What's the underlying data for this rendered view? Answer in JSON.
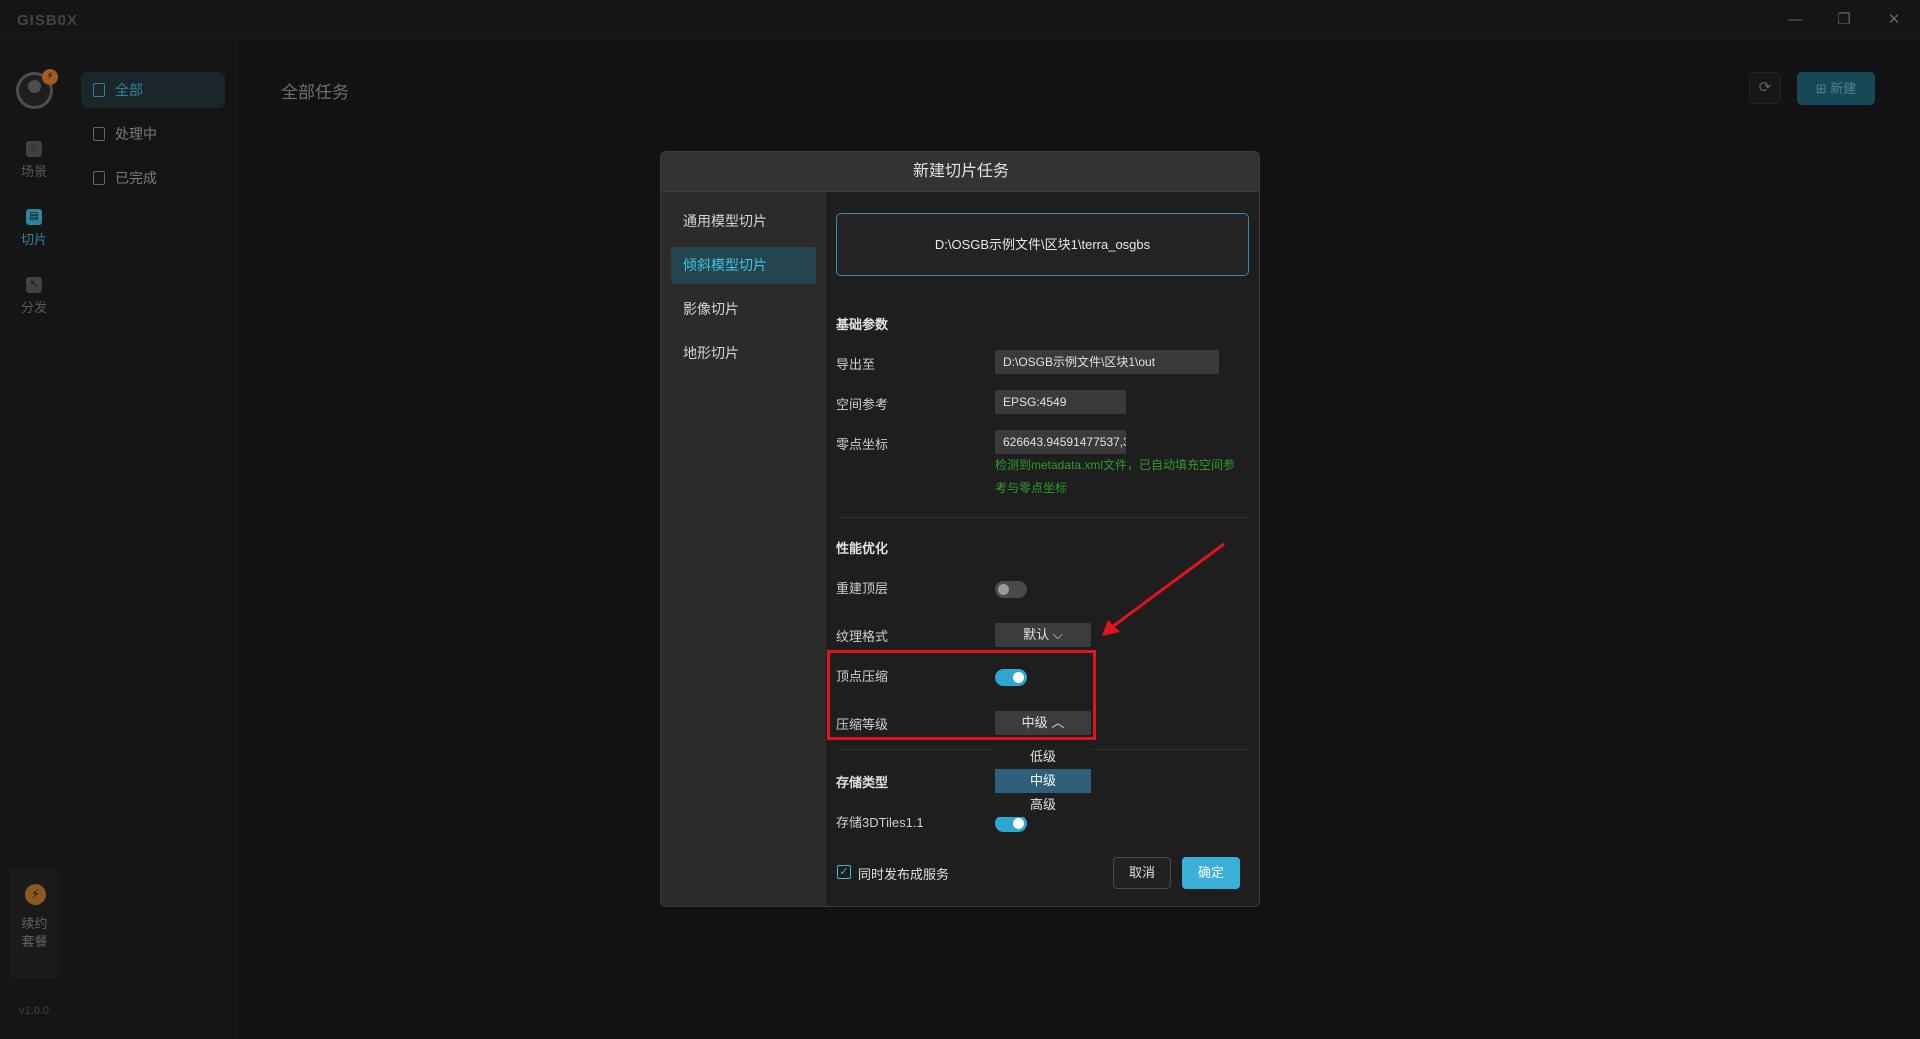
{
  "app": {
    "logo": "GISB0X",
    "version": "v1.0.0",
    "window_controls": [
      "minimize-icon",
      "restore-icon",
      "close-icon"
    ]
  },
  "rail": {
    "items": [
      {
        "label": "场景",
        "icon": "scene-icon",
        "active": false
      },
      {
        "label": "切片",
        "icon": "slice-icon",
        "active": true
      },
      {
        "label": "分发",
        "icon": "distribute-icon",
        "active": false
      }
    ],
    "renew_label_1": "续约",
    "renew_label_2": "套餐"
  },
  "sidebar": {
    "items": [
      {
        "label": "全部",
        "active": true
      },
      {
        "label": "处理中",
        "active": false
      },
      {
        "label": "已完成",
        "active": false
      }
    ]
  },
  "main": {
    "title": "全部任务",
    "new_button": "新建"
  },
  "dialog": {
    "title": "新建切片任务",
    "nav": [
      {
        "label": "通用模型切片",
        "active": false
      },
      {
        "label": "倾斜模型切片",
        "active": true
      },
      {
        "label": "影像切片",
        "active": false
      },
      {
        "label": "地形切片",
        "active": false
      }
    ],
    "source_path": "D:\\OSGB示例文件\\区块1\\terra_osgbs",
    "basic": {
      "title": "基础参数",
      "export_label": "导出至",
      "export_value": "D:\\OSGB示例文件\\区块1\\out",
      "srs_label": "空间参考",
      "srs_value": "EPSG:4549",
      "origin_label": "零点坐标",
      "origin_value": "626643.94591477537,3",
      "hint": "检测到metadata.xml文件，已自动填充空间参考与零点坐标"
    },
    "perf": {
      "title": "性能优化",
      "rebuild_label": "重建顶层",
      "rebuild_on": false,
      "texture_label": "纹理格式",
      "texture_value": "默认",
      "vertex_label": "顶点压缩",
      "vertex_on": true,
      "level_label": "压缩等级",
      "level_value": "中级",
      "level_options": [
        "低级",
        "中级",
        "高级"
      ]
    },
    "storage": {
      "title": "存储类型",
      "tiles_label": "存储3DTiles1.1",
      "tiles_on": true
    },
    "publish_label": "同时发布成服务",
    "publish_checked": true,
    "cancel": "取消",
    "ok": "确定"
  },
  "colors": {
    "accent": "#3fb9d8",
    "annotation": "#e0141e",
    "hint": "#2f9b2f"
  }
}
